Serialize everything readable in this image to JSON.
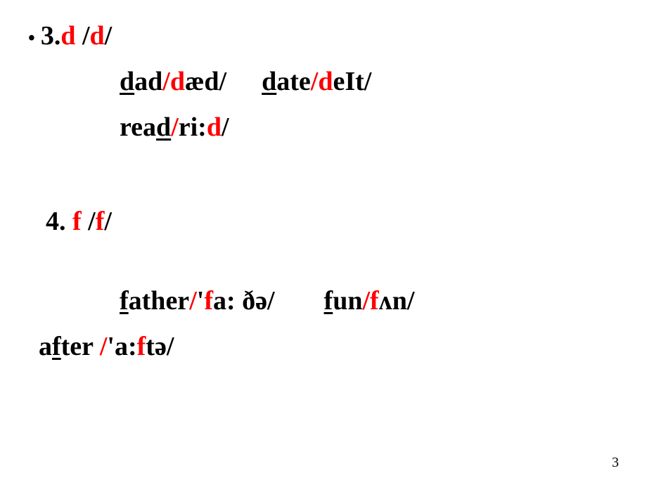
{
  "slide": {
    "item3": {
      "bullet": "•",
      "number": "3.",
      "letter": "d",
      "phoneme_open": " /",
      "phoneme_letter": "d",
      "phoneme_close": "/",
      "examples": {
        "dad": {
          "pre_underline": "",
          "underline_letter": "d",
          "rest": "ad",
          "slash1": "/",
          "ph_highlight": "d",
          "ph_rest": "æd/"
        },
        "date": {
          "pre_underline": "",
          "underline_letter": "d",
          "rest": "ate",
          "slash1": "/",
          "ph_highlight": "d",
          "ph_rest": "eIt/"
        },
        "read": {
          "pre": "rea",
          "underline_letter": "d",
          "rest": "",
          "slash1": "/",
          "ph_pre": "ri:",
          "ph_highlight": "d",
          "ph_close": "/"
        }
      }
    },
    "item4": {
      "number": "4. ",
      "letter": "f",
      "phoneme_open": " /",
      "phoneme_letter": "f",
      "phoneme_close": "/",
      "examples": {
        "father": {
          "underline_letter": "f",
          "rest": "ather",
          "slash1": "/",
          "stress": "'",
          "ph_highlight": "f",
          "ph_rest": "a: ðə/"
        },
        "fun": {
          "underline_letter": "f",
          "rest": "un",
          "slash1": "/",
          "ph_highlight": "f",
          "ph_rest": "ʌn/"
        },
        "after": {
          "pre": "a",
          "underline_letter": "f",
          "rest": "ter ",
          "slash1": "/",
          "stress": "'",
          "ph_pre": "a:",
          "ph_highlight": "f",
          "ph_rest": "tə/"
        }
      }
    },
    "page_number": "3"
  }
}
